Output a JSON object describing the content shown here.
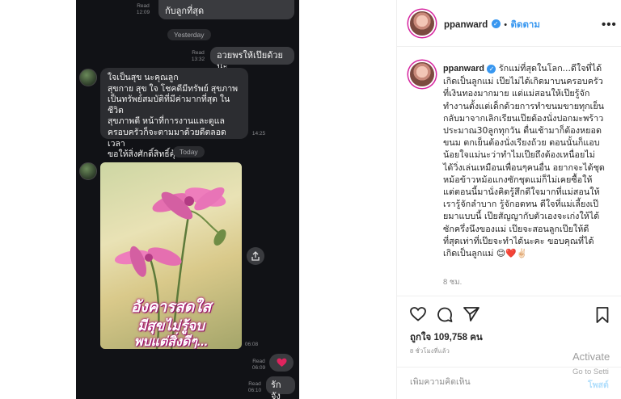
{
  "chat": {
    "top_bubble": "กับลูกที่สุด",
    "top_read": "Read",
    "top_time": "12:09",
    "day_yesterday": "Yesterday",
    "out1_read": "Read",
    "out1_time": "13:32",
    "out1_text": "อวยพรให้เป๊ยด้วยนะ",
    "in1_lines": [
      "ใจเป็นสุข นะคุณลูก",
      "สุขกาย สุข ใจ โชคดีมีทรัพย์ สุขภาพ",
      "เป็นทรัพย์สมบัติที่มีค่ามากที่สุด ในชีวิต",
      "สุขภาพดี หน้าที่การงานและดูแล",
      "ครอบครัวก็จะตามมาด้วยดีตลอดเวลา",
      "ขอให้สิ่งศักดิ์สิทธิ์คุ้มครอง"
    ],
    "in1_time": "14:25",
    "day_today": "Today",
    "photo_caption_1": "อังคารสดใส",
    "photo_caption_2": "มีสุขไม่รู้จบ",
    "photo_caption_3": "พบแต่สิ่งดีๆ...",
    "photo_time": "06:08",
    "heart_read": "Read",
    "heart_time": "06:09",
    "last_read": "Read",
    "last_time": "06:10",
    "last_text": "รักจัง"
  },
  "header": {
    "username": "ppanward",
    "dot": "•",
    "follow": "ติดตาม",
    "more": "•••"
  },
  "caption": {
    "username": "ppanward",
    "text": "รักแม่ที่สุดในโลก...ดีใจที่ได้เกิดเป็นลูกแม่ เป๊ยไม่ได้เกิดมาบนครอบครัวที่เงินทองมากมาย แต่แม่สอนให้เป๊ยรู้จักทำงานตั้งแต่เด็กด้วยการทำขนมขายทุกเย็นกลับมาจากเลิกเรียนเป๊ยต้องนั่งปอกมะพร้าวประมาณ30ลูกทุกวัน ตื่นเช้ามาก็ต้องหยอดขนม ตกเย็นต้องนั่งเรียงถ้วย ตอนนั้นก็แอบน้อยใจแม่นะว่าทำไมเป๊ยถึงต้องเหนื่อยไม่ได้วิ่งเล่นเหมือนเพื่อนๆคนอื่น อยากจะได้ชุดหม้อข้าวหม้อแกงซักชุดแม่ก็ไม่เคยซื้อให้ แต่ตอนนี้มานั่งคิดรู้สึกดีใจมากที่แม่สอนให้เรารู้จักลำบาก รู้จักอดทน ดีใจที่แม่เลี้ยงเป๊ยมาแบบนี้ เป๊ยสัญญากับตัวเองจะเก่งให้ได้ซักครึ่งนึงของแม่ เป๊ยจะสอนลูกเป๊ยให้ดีที่สุดเท่าที่เป๊ยจะทำได้นะคะ ขอบคุณที่ได้เกิดเป็นลูกแม่ 😊❤️✌🏻",
    "time_ago": "8 ชม."
  },
  "actions": {
    "likes": "ถูกใจ 109,758 คน",
    "posted": "8 ชั่วโมงที่แล้ว"
  },
  "comment": {
    "placeholder": "เพิ่มความคิดเห็น",
    "post": "โพสต์"
  },
  "watermark": {
    "line1": "Activate",
    "line2": "Go to Setti"
  },
  "icons": {
    "heart": "heart-outline-icon",
    "comment": "comment-icon",
    "share": "paper-plane-icon",
    "save": "bookmark-icon"
  },
  "colors": {
    "accent": "#3897f0",
    "chat_bg": "#111216"
  }
}
